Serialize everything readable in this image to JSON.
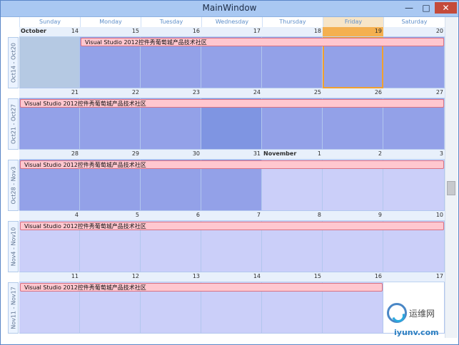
{
  "window": {
    "title": "MainWindow",
    "minimize_glyph": "—",
    "maximize_glyph": "□",
    "close_glyph": "✕"
  },
  "day_headers": [
    "Sunday",
    "Monday",
    "Tuesday",
    "Wednesday",
    "Thursday",
    "Friday",
    "Saturday"
  ],
  "weeks": [
    {
      "label": "Oct14 - Oct20",
      "days": [
        {
          "num": "14",
          "month": "October",
          "state": "sel"
        },
        {
          "num": "15",
          "state": "cur"
        },
        {
          "num": "16",
          "state": "cur"
        },
        {
          "num": "17",
          "state": "cur"
        },
        {
          "num": "18",
          "state": "cur"
        },
        {
          "num": "19",
          "state": "cur",
          "today": true
        },
        {
          "num": "20",
          "state": "cur"
        }
      ],
      "event": {
        "text": "Visual Studio 2012控件秀葡萄城产品技术社区",
        "start": 1,
        "span": 6
      }
    },
    {
      "label": "Oct21 - Oct27",
      "days": [
        {
          "num": "21",
          "state": "cur"
        },
        {
          "num": "22",
          "state": "cur"
        },
        {
          "num": "23",
          "state": "cur"
        },
        {
          "num": "24",
          "state": "highlight"
        },
        {
          "num": "25",
          "state": "cur"
        },
        {
          "num": "26",
          "state": "cur"
        },
        {
          "num": "27",
          "state": "cur"
        }
      ],
      "event": {
        "text": "Visual Studio 2012控件秀葡萄城产品技术社区",
        "start": 0,
        "span": 7
      }
    },
    {
      "label": "Oct28 - Nov3",
      "days": [
        {
          "num": "28",
          "state": "cur"
        },
        {
          "num": "29",
          "state": "cur"
        },
        {
          "num": "30",
          "state": "cur"
        },
        {
          "num": "31",
          "state": "cur"
        },
        {
          "num": "1",
          "month": "November",
          "state": "next"
        },
        {
          "num": "2",
          "state": "next"
        },
        {
          "num": "3",
          "state": "next"
        }
      ],
      "event": {
        "text": "Visual Studio 2012控件秀葡萄城产品技术社区",
        "start": 0,
        "span": 7
      }
    },
    {
      "label": "Nov4 - Nov10",
      "days": [
        {
          "num": "4",
          "state": "next"
        },
        {
          "num": "5",
          "state": "next"
        },
        {
          "num": "6",
          "state": "next"
        },
        {
          "num": "7",
          "state": "next"
        },
        {
          "num": "8",
          "state": "next"
        },
        {
          "num": "9",
          "state": "next"
        },
        {
          "num": "10",
          "state": "next"
        }
      ],
      "event": {
        "text": "Visual Studio 2012控件秀葡萄城产品技术社区",
        "start": 0,
        "span": 7
      }
    },
    {
      "label": "Nov11 - Nov17",
      "days": [
        {
          "num": "11",
          "state": "next"
        },
        {
          "num": "12",
          "state": "next"
        },
        {
          "num": "13",
          "state": "next"
        },
        {
          "num": "14",
          "state": "next"
        },
        {
          "num": "15",
          "state": "next"
        },
        {
          "num": "16",
          "state": "next"
        },
        {
          "num": "17",
          "state": "empty"
        }
      ],
      "event": {
        "text": "Visual Studio 2012控件秀葡萄城产品技术社区",
        "start": 0,
        "span": 6
      }
    }
  ],
  "watermark": {
    "cn": "运维网",
    "site": "iyunv.com"
  }
}
